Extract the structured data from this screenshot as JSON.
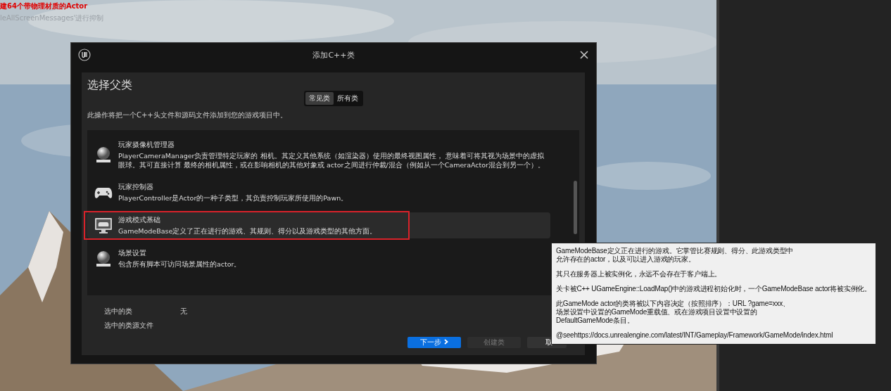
{
  "viewport_messages": [
    {
      "text": "建64个带物理材质的Actor",
      "kind": "error"
    },
    {
      "text": "leAllScreenMessages'进行抑制",
      "kind": "info"
    }
  ],
  "dialog": {
    "title": "添加C++类",
    "heading": "选择父类",
    "tabs": [
      {
        "label": "常见类",
        "selected": true
      },
      {
        "label": "所有类",
        "selected": false
      }
    ],
    "description": "此操作将把一个C++头文件和源码文件添加到您的游戏项目中。",
    "classes": [
      {
        "kind": "camera",
        "name": "玩家摄像机管理器",
        "description": "PlayerCameraManager负责管理特定玩家的 相机。其定义其他系统（如渲染器）使用的最终视图属性， 意味着可将其视为场景中的虚拟眼球。其可直接计算 最终的相机属性，或在影响相机的其他对象或 actor之间进行仲裁/混合（例如从一个CameraActor混合到另一个）。",
        "selected": false
      },
      {
        "kind": "gamepad",
        "name": "玩家控制器",
        "description": "PlayerController是Actor的一种子类型，其负责控制玩家所使用的Pawn。",
        "selected": false
      },
      {
        "kind": "monitor",
        "name": "游戏模式基础",
        "description": "GameModeBase定义了正在进行的游戏、其规则、得分以及游戏类型的其他方面。",
        "selected": true
      },
      {
        "kind": "sphere",
        "name": "场景设置",
        "description": "包含所有脚本可访问场景属性的actor。",
        "selected": false
      }
    ],
    "selected_class": {
      "label": "选中的类",
      "value": "无"
    },
    "selected_source": {
      "label": "选中的类源文件"
    },
    "buttons": [
      {
        "label": "下一步",
        "kind": "primary",
        "disabled": false
      },
      {
        "label": "创建类",
        "kind": "normal",
        "disabled": true
      },
      {
        "label": "取",
        "kind": "normal",
        "disabled": false
      }
    ]
  },
  "tooltip": {
    "paragraphs": [
      [
        "GameModeBase定义正在进行的游戏。它掌管比赛规则、得分、此游戏类型中",
        "允许存在的actor，以及可以进入游戏的玩家。"
      ],
      [
        "其只在服务器上被实例化，永远不会存在于客户端上。"
      ],
      [
        "关卡被C++ UGameEngine::LoadMap()中的游戏进程初始化时，一个GameModeBase actor将被实例化。"
      ],
      [
        "此GameMode actor的类将被以下内容决定（按照排序）：URL ?game=xxx、",
        "场景设置中设置的GameMode重载值、或在游戏项目设置中设置的",
        "DefaultGameMode条目。"
      ],
      [
        "@seehttps://docs.unrealengine.com/latest/INT/Gameplay/Framework/GameMode/index.html"
      ]
    ]
  }
}
